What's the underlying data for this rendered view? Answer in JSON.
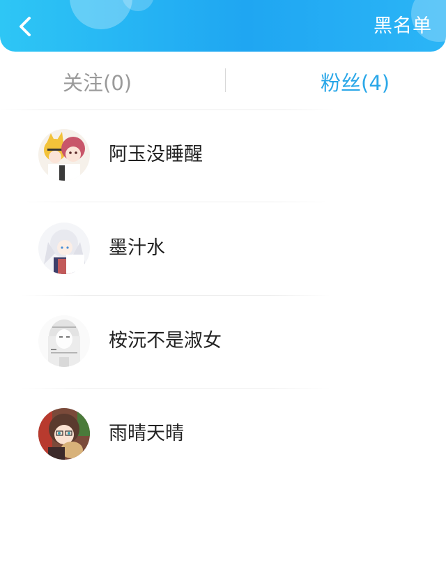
{
  "header": {
    "back_icon": "chevron-left-icon",
    "right_action": "黑名单",
    "accent_color": "#1fa6f2"
  },
  "tabs": [
    {
      "label": "关注(0)",
      "active": false
    },
    {
      "label": "粉丝(4)",
      "active": true
    }
  ],
  "fans": [
    {
      "name": "阿玉没睡醒",
      "avatar": "anime-duo-avatar"
    },
    {
      "name": "墨汁水",
      "avatar": "white-hair-anime-avatar"
    },
    {
      "name": "桉沅不是淑女",
      "avatar": "sketch-girl-avatar"
    },
    {
      "name": "雨晴天晴",
      "avatar": "brown-hair-glasses-avatar"
    }
  ]
}
